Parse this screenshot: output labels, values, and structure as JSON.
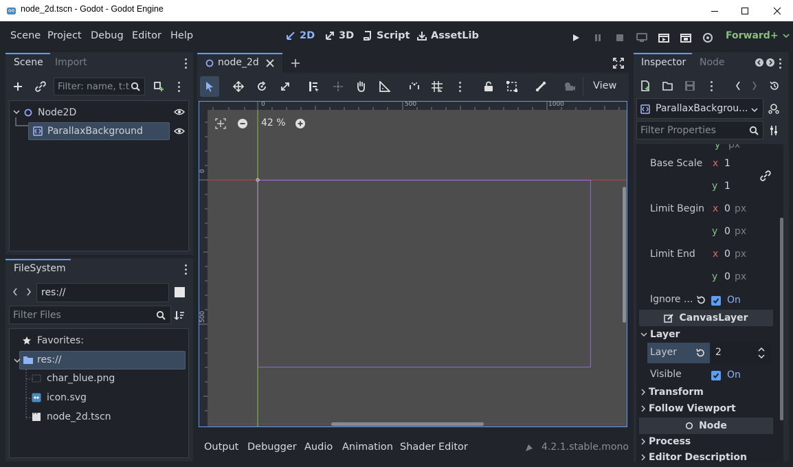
{
  "window": {
    "title": "node_2d.tscn - Godot - Godot Engine"
  },
  "menu": [
    "Scene",
    "Project",
    "Debug",
    "Editor",
    "Help"
  ],
  "workspaces": [
    {
      "label": "2D",
      "icon": "2d-icon",
      "active": true
    },
    {
      "label": "3D",
      "icon": "3d-icon",
      "active": false
    },
    {
      "label": "Script",
      "icon": "script-icon",
      "active": false
    },
    {
      "label": "AssetLib",
      "icon": "assetlib-icon",
      "active": false
    }
  ],
  "renderer": "Forward+",
  "scene_dock": {
    "tabs": [
      "Scene",
      "Import"
    ],
    "filter_placeholder": "Filter: name, t:t",
    "tree": [
      {
        "label": "Node2D",
        "icon": "node2d-icon"
      },
      {
        "label": "ParallaxBackground",
        "icon": "parallax-background-icon",
        "selected": true
      }
    ]
  },
  "filesystem": {
    "tab": "FileSystem",
    "path": "res://",
    "filter_placeholder": "Filter Files",
    "favorites_label": "Favorites:",
    "root": "res://",
    "files": [
      {
        "label": "char_blue.png",
        "icon": "image-file-icon"
      },
      {
        "label": "icon.svg",
        "icon": "svg-file-icon"
      },
      {
        "label": "node_2d.tscn",
        "icon": "scene-file-icon"
      }
    ]
  },
  "editor_tab": {
    "label": "node_2d"
  },
  "toolbar": {
    "view_label": "View"
  },
  "viewport": {
    "zoom": "42 %",
    "ruler_h": [
      "0",
      "500",
      "1000"
    ],
    "ruler_v": [
      "0",
      "500"
    ]
  },
  "inspector": {
    "tabs": [
      "Inspector",
      "Node"
    ],
    "node_selector": "ParallaxBackgrou...",
    "filter_placeholder": "Filter Properties",
    "props": {
      "base_scale_label": "Base Scale",
      "base_scale_x": "1",
      "base_scale_y": "1",
      "limit_begin_label": "Limit Begin",
      "limit_begin_x": "0",
      "limit_begin_y": "0",
      "limit_end_label": "Limit End",
      "limit_end_x": "0",
      "limit_end_y": "0",
      "px": "px",
      "x": "x",
      "y": "y",
      "ignore_label": "Ignore ...",
      "ignore_value": "On",
      "canvas_layer_section": "CanvasLayer",
      "layer_group": "Layer",
      "layer_label": "Layer",
      "layer_value": "2",
      "visible_label": "Visible",
      "visible_value": "On",
      "transform_group": "Transform",
      "follow_viewport_group": "Follow Viewport",
      "node_section": "Node",
      "process_group": "Process",
      "editor_description_group": "Editor Description"
    }
  },
  "bottom_panel": {
    "tabs": [
      "Output",
      "Debugger",
      "Audio",
      "Animation",
      "Shader Editor"
    ],
    "version": "4.2.1.stable.mono"
  },
  "colors": {
    "accent": "#5a9ff4",
    "bg": "#21252b",
    "panel": "#282c34",
    "viewport": "#4d4d4d",
    "x_axis": "#d66a6a",
    "y_axis": "#7fc97f"
  }
}
